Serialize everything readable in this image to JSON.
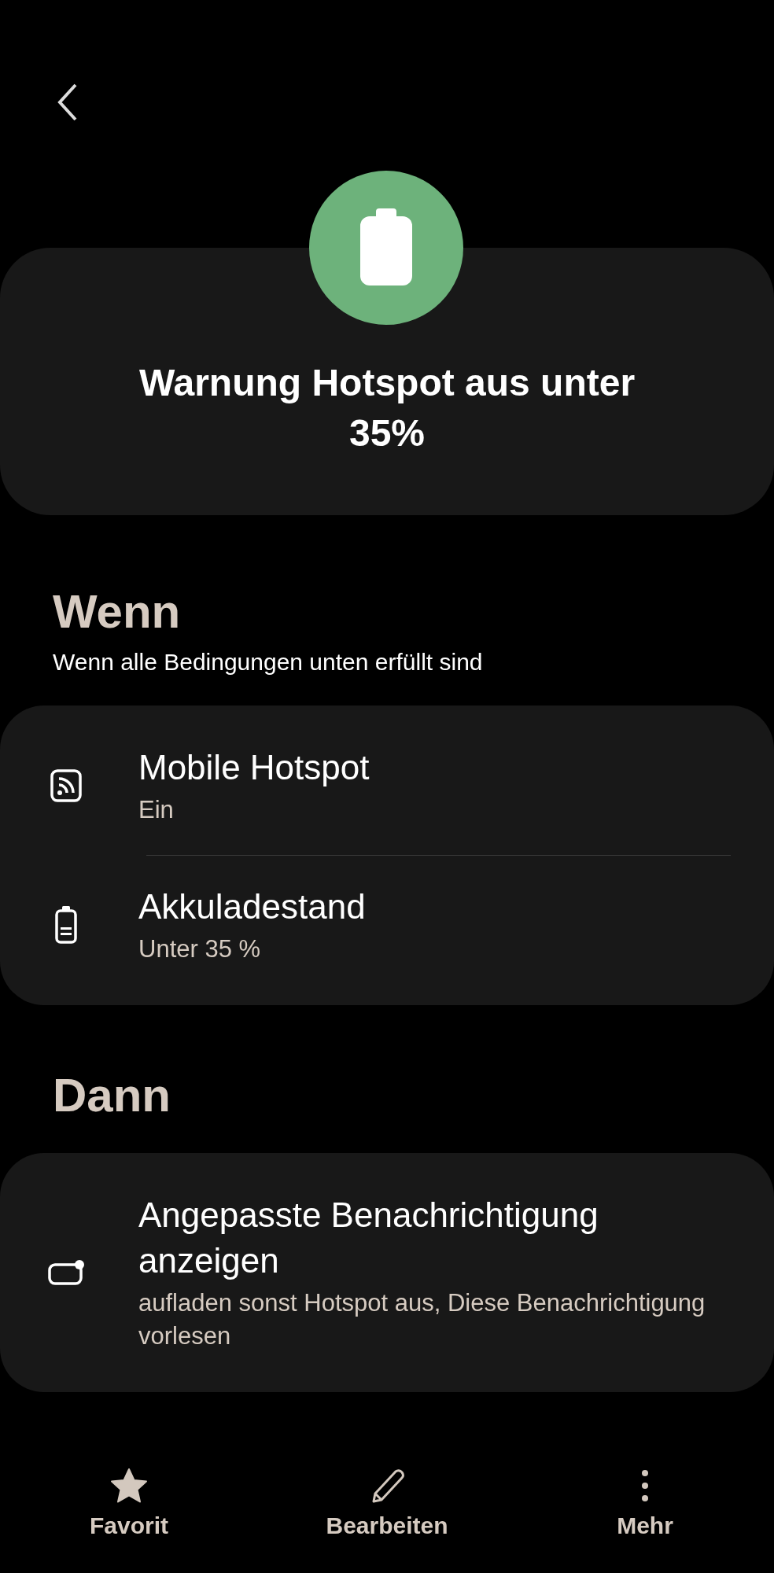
{
  "header": {
    "title": "Warnung Hotspot aus unter 35%"
  },
  "sections": [
    {
      "heading": "Wenn",
      "subtitle": "Wenn alle Bedingungen unten erfüllt sind",
      "items": [
        {
          "kind": "hotspot",
          "title": "Mobile Hotspot",
          "subtitle": "Ein"
        },
        {
          "kind": "battery",
          "title": "Akkuladestand",
          "subtitle": "Unter 35 %"
        }
      ]
    },
    {
      "heading": "Dann",
      "items": [
        {
          "kind": "notification",
          "title": "Angepasste Benachrichtigung anzeigen",
          "subtitle": "aufladen sonst Hotspot aus, Diese Benachrichtigung vorlesen"
        }
      ]
    }
  ],
  "bottom_nav": [
    {
      "kind": "star",
      "label": "Favorit"
    },
    {
      "kind": "pencil",
      "label": "Bearbeiten"
    },
    {
      "kind": "more",
      "label": "Mehr"
    }
  ]
}
